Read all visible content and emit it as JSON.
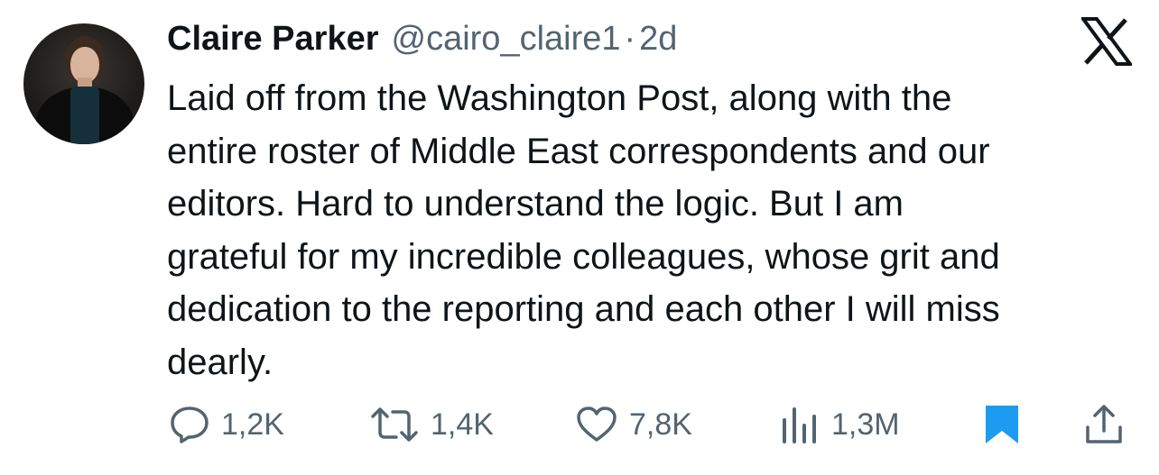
{
  "tweet": {
    "author_name": "Claire Parker",
    "author_handle": "@cairo_claire1",
    "separator": "·",
    "time_ago": "2d",
    "text_lines": [
      "Laid off from the Washington Post, along with the",
      "entire roster of Middle East correspondents and our",
      "editors. Hard to understand the logic. But I am",
      "grateful for my incredible colleagues, whose grit and",
      "dedication to the reporting and each other I will miss",
      "dearly."
    ]
  },
  "actions": {
    "replies": "1,2K",
    "reposts": "1,4K",
    "likes": "7,8K",
    "views": "1,3M"
  },
  "icons": {
    "logo": "x-logo-icon",
    "reply": "reply-icon",
    "repost": "repost-icon",
    "like": "heart-icon",
    "views": "views-icon",
    "bookmark": "bookmark-icon",
    "share": "share-icon"
  },
  "colors": {
    "text": "#0f1419",
    "secondary": "#536471",
    "bookmark_active": "#1d9bf0"
  }
}
